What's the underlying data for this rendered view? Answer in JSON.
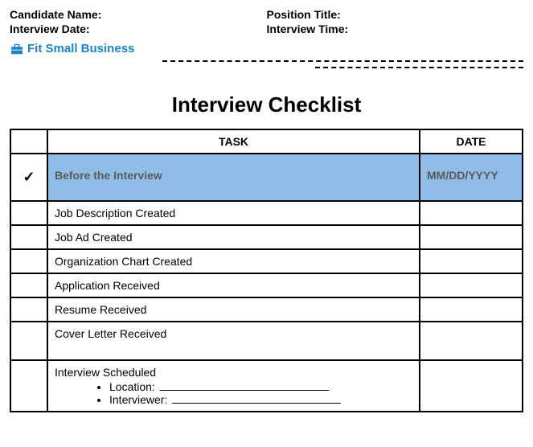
{
  "header": {
    "candidate_label": "Candidate Name:",
    "interview_date_label": "Interview Date:",
    "position_label": "Position Title:",
    "interview_time_label": "Interview Time:"
  },
  "brand": {
    "icon_name": "briefcase-icon",
    "text": "Fit Small Business"
  },
  "title": "Interview Checklist",
  "columns": {
    "task": "TASK",
    "date": "DATE"
  },
  "section": {
    "check": "✓",
    "label": "Before the Interview",
    "date_placeholder": "MM/DD/YYYY"
  },
  "tasks": [
    "Job Description Created",
    "Job Ad Created",
    "Organization Chart Created",
    "Application Received",
    "Resume Received",
    "Cover Letter Received"
  ],
  "scheduled": {
    "label": "Interview Scheduled",
    "location_label": "Location:",
    "interviewer_label": "Interviewer:"
  }
}
